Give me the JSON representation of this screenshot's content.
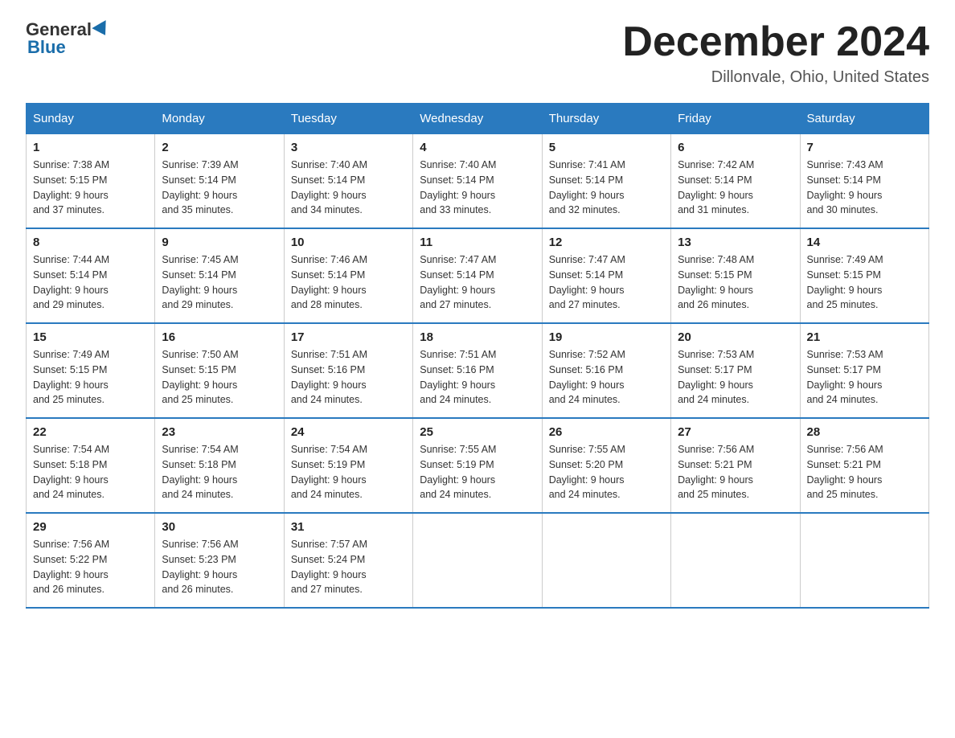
{
  "logo": {
    "general": "General",
    "blue": "Blue",
    "subtitle": "Blue"
  },
  "title": {
    "month_year": "December 2024",
    "location": "Dillonvale, Ohio, United States"
  },
  "days_of_week": [
    "Sunday",
    "Monday",
    "Tuesday",
    "Wednesday",
    "Thursday",
    "Friday",
    "Saturday"
  ],
  "weeks": [
    [
      {
        "day": "1",
        "sunrise": "7:38 AM",
        "sunset": "5:15 PM",
        "daylight": "9 hours and 37 minutes."
      },
      {
        "day": "2",
        "sunrise": "7:39 AM",
        "sunset": "5:14 PM",
        "daylight": "9 hours and 35 minutes."
      },
      {
        "day": "3",
        "sunrise": "7:40 AM",
        "sunset": "5:14 PM",
        "daylight": "9 hours and 34 minutes."
      },
      {
        "day": "4",
        "sunrise": "7:40 AM",
        "sunset": "5:14 PM",
        "daylight": "9 hours and 33 minutes."
      },
      {
        "day": "5",
        "sunrise": "7:41 AM",
        "sunset": "5:14 PM",
        "daylight": "9 hours and 32 minutes."
      },
      {
        "day": "6",
        "sunrise": "7:42 AM",
        "sunset": "5:14 PM",
        "daylight": "9 hours and 31 minutes."
      },
      {
        "day": "7",
        "sunrise": "7:43 AM",
        "sunset": "5:14 PM",
        "daylight": "9 hours and 30 minutes."
      }
    ],
    [
      {
        "day": "8",
        "sunrise": "7:44 AM",
        "sunset": "5:14 PM",
        "daylight": "9 hours and 29 minutes."
      },
      {
        "day": "9",
        "sunrise": "7:45 AM",
        "sunset": "5:14 PM",
        "daylight": "9 hours and 29 minutes."
      },
      {
        "day": "10",
        "sunrise": "7:46 AM",
        "sunset": "5:14 PM",
        "daylight": "9 hours and 28 minutes."
      },
      {
        "day": "11",
        "sunrise": "7:47 AM",
        "sunset": "5:14 PM",
        "daylight": "9 hours and 27 minutes."
      },
      {
        "day": "12",
        "sunrise": "7:47 AM",
        "sunset": "5:14 PM",
        "daylight": "9 hours and 27 minutes."
      },
      {
        "day": "13",
        "sunrise": "7:48 AM",
        "sunset": "5:15 PM",
        "daylight": "9 hours and 26 minutes."
      },
      {
        "day": "14",
        "sunrise": "7:49 AM",
        "sunset": "5:15 PM",
        "daylight": "9 hours and 25 minutes."
      }
    ],
    [
      {
        "day": "15",
        "sunrise": "7:49 AM",
        "sunset": "5:15 PM",
        "daylight": "9 hours and 25 minutes."
      },
      {
        "day": "16",
        "sunrise": "7:50 AM",
        "sunset": "5:15 PM",
        "daylight": "9 hours and 25 minutes."
      },
      {
        "day": "17",
        "sunrise": "7:51 AM",
        "sunset": "5:16 PM",
        "daylight": "9 hours and 24 minutes."
      },
      {
        "day": "18",
        "sunrise": "7:51 AM",
        "sunset": "5:16 PM",
        "daylight": "9 hours and 24 minutes."
      },
      {
        "day": "19",
        "sunrise": "7:52 AM",
        "sunset": "5:16 PM",
        "daylight": "9 hours and 24 minutes."
      },
      {
        "day": "20",
        "sunrise": "7:53 AM",
        "sunset": "5:17 PM",
        "daylight": "9 hours and 24 minutes."
      },
      {
        "day": "21",
        "sunrise": "7:53 AM",
        "sunset": "5:17 PM",
        "daylight": "9 hours and 24 minutes."
      }
    ],
    [
      {
        "day": "22",
        "sunrise": "7:54 AM",
        "sunset": "5:18 PM",
        "daylight": "9 hours and 24 minutes."
      },
      {
        "day": "23",
        "sunrise": "7:54 AM",
        "sunset": "5:18 PM",
        "daylight": "9 hours and 24 minutes."
      },
      {
        "day": "24",
        "sunrise": "7:54 AM",
        "sunset": "5:19 PM",
        "daylight": "9 hours and 24 minutes."
      },
      {
        "day": "25",
        "sunrise": "7:55 AM",
        "sunset": "5:19 PM",
        "daylight": "9 hours and 24 minutes."
      },
      {
        "day": "26",
        "sunrise": "7:55 AM",
        "sunset": "5:20 PM",
        "daylight": "9 hours and 24 minutes."
      },
      {
        "day": "27",
        "sunrise": "7:56 AM",
        "sunset": "5:21 PM",
        "daylight": "9 hours and 25 minutes."
      },
      {
        "day": "28",
        "sunrise": "7:56 AM",
        "sunset": "5:21 PM",
        "daylight": "9 hours and 25 minutes."
      }
    ],
    [
      {
        "day": "29",
        "sunrise": "7:56 AM",
        "sunset": "5:22 PM",
        "daylight": "9 hours and 26 minutes."
      },
      {
        "day": "30",
        "sunrise": "7:56 AM",
        "sunset": "5:23 PM",
        "daylight": "9 hours and 26 minutes."
      },
      {
        "day": "31",
        "sunrise": "7:57 AM",
        "sunset": "5:24 PM",
        "daylight": "9 hours and 27 minutes."
      },
      null,
      null,
      null,
      null
    ]
  ],
  "labels": {
    "sunrise": "Sunrise:",
    "sunset": "Sunset:",
    "daylight": "Daylight:"
  }
}
